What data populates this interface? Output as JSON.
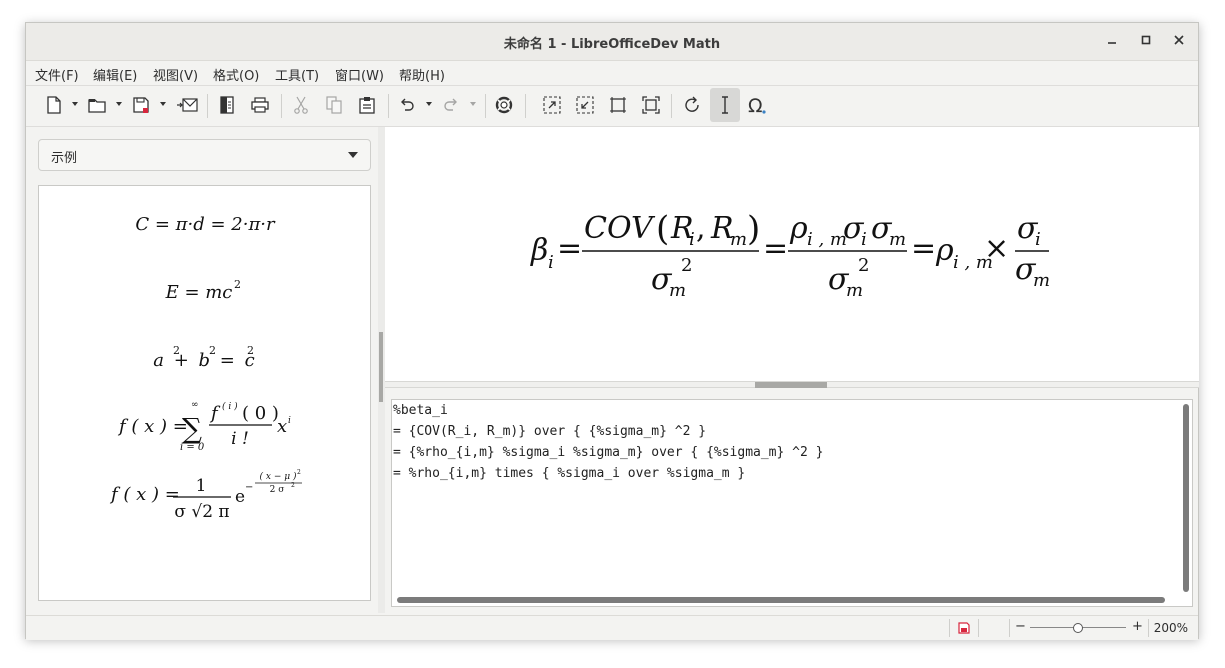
{
  "window": {
    "title": "未命名 1 - LibreOfficeDev Math"
  },
  "menu": [
    "文件(F)",
    "编辑(E)",
    "视图(V)",
    "格式(O)",
    "工具(T)",
    "窗口(W)",
    "帮助(H)"
  ],
  "sidebar": {
    "dropdown_value": "示例"
  },
  "editor": {
    "lines": [
      "%beta_i",
      "= {COV(R_i, R_m)} over { {%sigma_m} ^2 }",
      "= {%rho_{i,m} %sigma_i %sigma_m} over { {%sigma_m} ^2 }",
      "= %rho_{i,m} times { %sigma_i over %sigma_m }"
    ]
  },
  "status": {
    "zoom_minus": "−",
    "zoom_plus": "+",
    "zoom": "200%",
    "zoom_level": 0.5
  },
  "formula": {
    "beta": "β",
    "i": "i",
    "eq": "=",
    "cov": "COV",
    "lparen": "(",
    "rparen": ")",
    "R": "R",
    "m": "m",
    "comma": ",",
    "sigma": "σ",
    "two": "2",
    "rho": "ρ",
    "im": "i , m",
    "times": "×"
  },
  "examples": {
    "ex1": "C = π·d = 2·π·r",
    "ex2": "E = mc",
    "ex3": "a + b = c",
    "sup2": "2",
    "sum": "∑",
    "inf": "∞",
    "i0": "i = 0",
    "fx": "f ( x ) =",
    "fi": "f",
    "isup": "( i )",
    "zero": "( 0 )",
    "ifact": "i !",
    "x": "x",
    "xi": "i",
    "one": "1",
    "den": "σ √2 π",
    "e": "e",
    "expnum": "( x − μ )",
    "expden": "2 σ",
    "neg": "−"
  }
}
